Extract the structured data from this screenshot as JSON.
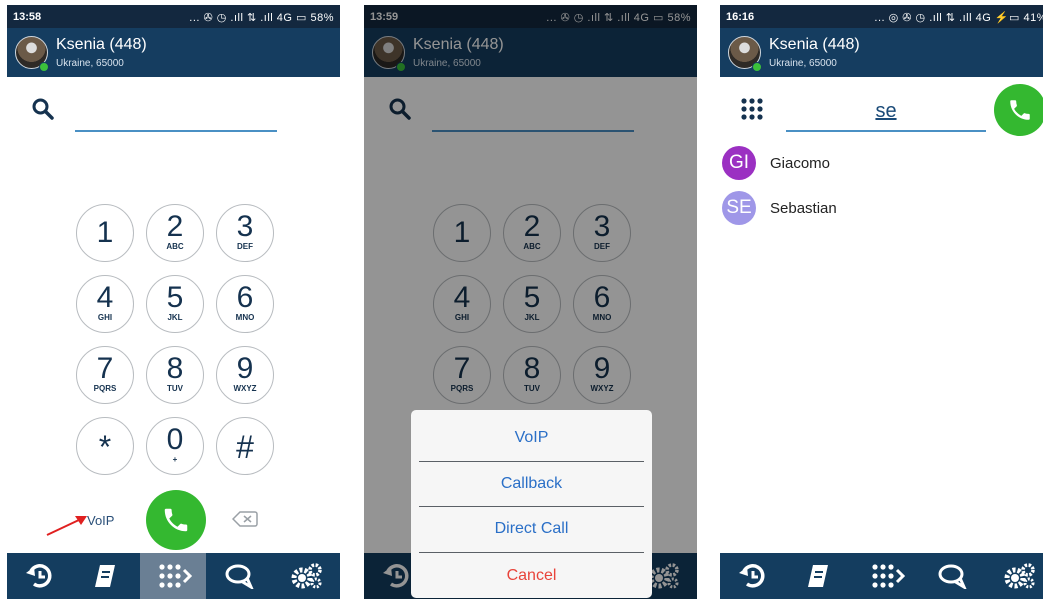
{
  "screens": [
    {
      "status_time": "13:58",
      "status_icons": "... ✇ ◷ .ıll ⇅ .ıll 4G ▭ 58%",
      "account_name": "Ksenia (448)",
      "account_location": "Ukraine, 65000",
      "dialed_number": "",
      "keys": [
        {
          "digit": "1",
          "letters": ""
        },
        {
          "digit": "2",
          "letters": "ABC"
        },
        {
          "digit": "3",
          "letters": "DEF"
        },
        {
          "digit": "4",
          "letters": "GHI"
        },
        {
          "digit": "5",
          "letters": "JKL"
        },
        {
          "digit": "6",
          "letters": "MNO"
        },
        {
          "digit": "7",
          "letters": "PQRS"
        },
        {
          "digit": "8",
          "letters": "TUV"
        },
        {
          "digit": "9",
          "letters": "WXYZ"
        },
        {
          "digit": "*",
          "letters": ""
        },
        {
          "digit": "0",
          "letters": "+"
        },
        {
          "digit": "#",
          "letters": ""
        }
      ],
      "call_mode": "VoIP",
      "bottom_nav": [
        "history-icon",
        "contacts-book-icon",
        "dialpad-icon",
        "chat-icon",
        "settings-gears-icon"
      ],
      "active_tab": "dialpad"
    },
    {
      "status_time": "13:59",
      "status_icons": "... ✇ ◷ .ıll ⇅ .ıll 4G ▭ 58%",
      "account_name": "Ksenia (448)",
      "account_location": "Ukraine, 65000",
      "dialed_number": "",
      "call_mode_options": [
        "VoIP",
        "Callback",
        "Direct  Call"
      ],
      "cancel_label": "Cancel"
    },
    {
      "status_time": "16:16",
      "status_icons": "... ◎ ✇ ◷ .ıll ⇅ .ıll 4G ⚡▭ 41%",
      "account_name": "Ksenia (448)",
      "account_location": "Ukraine, 65000",
      "search_query": "se",
      "contacts": [
        {
          "initials": "GI",
          "name": "Giacomo",
          "color": "#9b30c2"
        },
        {
          "initials": "SE",
          "name": "Sebastian",
          "color": "#9f97e8"
        }
      ]
    }
  ],
  "colors": {
    "header": "#153d60",
    "statusbar": "#13283f",
    "call_green": "#34b830",
    "accent_blue": "#2a6fc7",
    "cancel_red": "#e8433a"
  }
}
